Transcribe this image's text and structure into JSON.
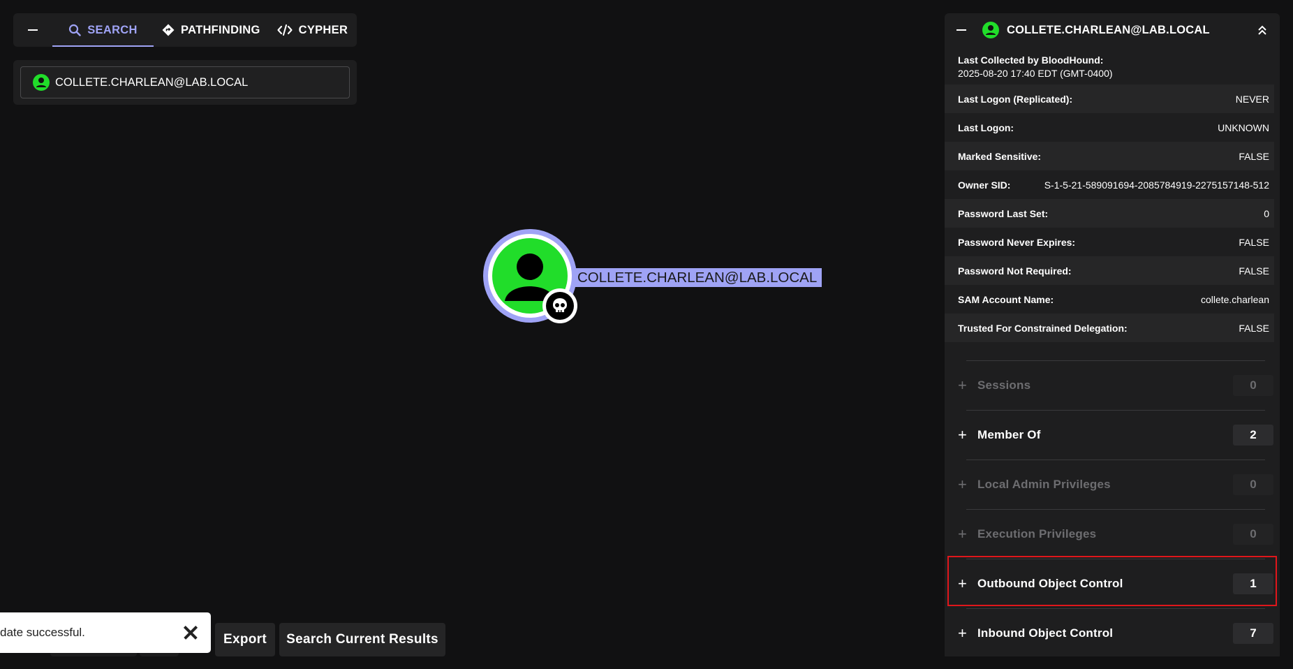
{
  "search_panel": {
    "tabs": [
      {
        "label": "SEARCH",
        "icon": "search-icon",
        "active": true
      },
      {
        "label": "PATHFINDING",
        "icon": "diamond-route-icon",
        "active": false
      },
      {
        "label": "CYPHER",
        "icon": "code-icon",
        "active": false
      }
    ],
    "search_value": "COLLETE.CHARLEAN@LAB.LOCAL"
  },
  "graph": {
    "node_label": "COLLETE.CHARLEAN@LAB.LOCAL",
    "node_icon": "user-icon",
    "badge_icon": "skull-icon"
  },
  "toast": {
    "message": "date successful."
  },
  "bottom_buttons": {
    "export": "Export",
    "search_current": "Search Current Results"
  },
  "entity_panel": {
    "title": "COLLETE.CHARLEAN@LAB.LOCAL",
    "last_collected_label": "Last Collected by BloodHound:",
    "last_collected_value": "2025-08-20 17:40 EDT (GMT-0400)",
    "properties": [
      {
        "key": "Last Logon (Replicated):",
        "value": "NEVER"
      },
      {
        "key": "Last Logon:",
        "value": "UNKNOWN"
      },
      {
        "key": "Marked Sensitive:",
        "value": "FALSE"
      },
      {
        "key": "Owner SID:",
        "value": "S-1-5-21-589091694-2085784919-2275157148-512"
      },
      {
        "key": "Password Last Set:",
        "value": "0"
      },
      {
        "key": "Password Never Expires:",
        "value": "FALSE"
      },
      {
        "key": "Password Not Required:",
        "value": "FALSE"
      },
      {
        "key": "SAM Account Name:",
        "value": "collete.charlean"
      },
      {
        "key": "Trusted For Constrained Delegation:",
        "value": "FALSE"
      }
    ],
    "sections": [
      {
        "label": "Sessions",
        "count": "0",
        "enabled": false
      },
      {
        "label": "Member Of",
        "count": "2",
        "enabled": true
      },
      {
        "label": "Local Admin Privileges",
        "count": "0",
        "enabled": false
      },
      {
        "label": "Execution Privileges",
        "count": "0",
        "enabled": false
      },
      {
        "label": "Outbound Object Control",
        "count": "1",
        "enabled": true,
        "highlighted": true
      },
      {
        "label": "Inbound Object Control",
        "count": "7",
        "enabled": true
      }
    ]
  },
  "colors": {
    "accent": "#9fa3f5",
    "user_green": "#21dd2a",
    "highlight_red": "#e0161b",
    "panel_bg": "#1e1e1f",
    "canvas_bg": "#111112"
  }
}
